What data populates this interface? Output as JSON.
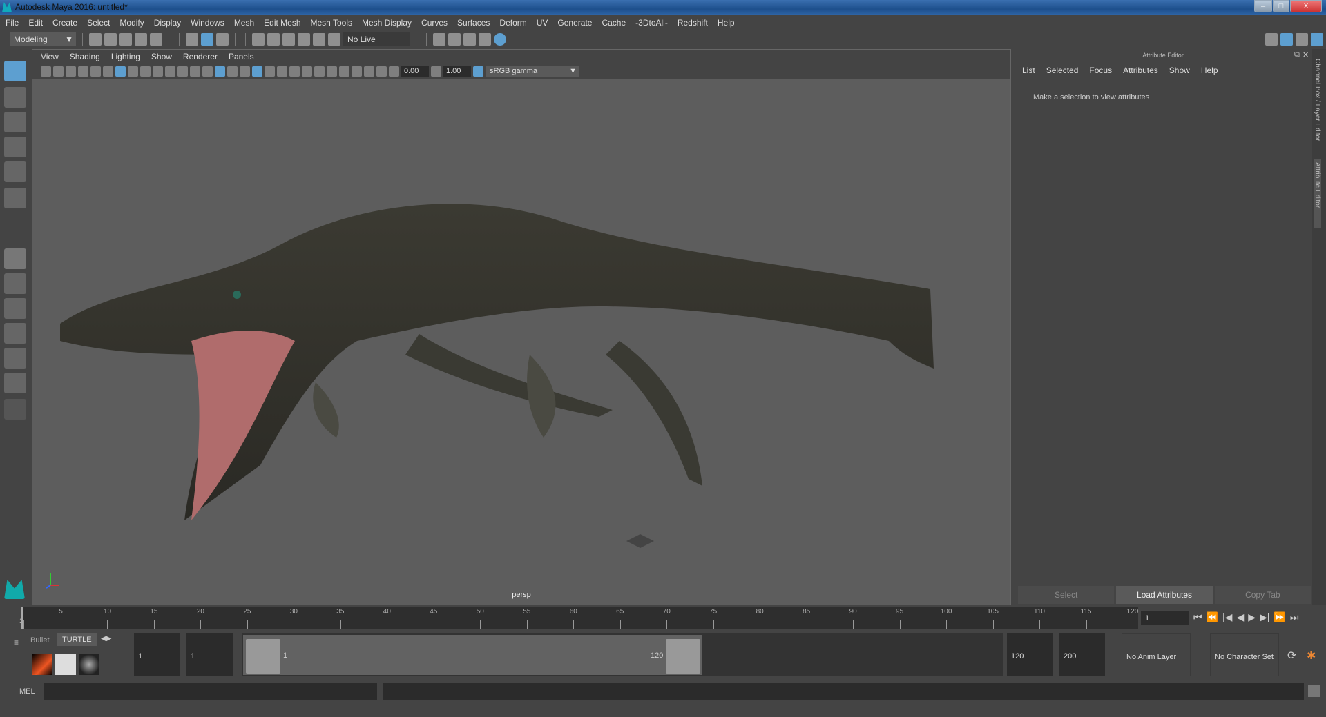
{
  "window": {
    "title": "Autodesk Maya 2016: untitled*",
    "min": "‒",
    "max": "□",
    "close": "X"
  },
  "menubar": [
    "File",
    "Edit",
    "Create",
    "Select",
    "Modify",
    "Display",
    "Windows",
    "Mesh",
    "Edit Mesh",
    "Mesh Tools",
    "Mesh Display",
    "Curves",
    "Surfaces",
    "Deform",
    "UV",
    "Generate",
    "Cache",
    "-3DtoAll-",
    "Redshift",
    "Help"
  ],
  "toolbar": {
    "mode": "Modeling",
    "live_surface": "No Live Surface"
  },
  "viewport": {
    "menu": [
      "View",
      "Shading",
      "Lighting",
      "Show",
      "Renderer",
      "Panels"
    ],
    "exposure": "0.00",
    "gamma": "1.00",
    "color_space": "sRGB gamma",
    "camera": "persp"
  },
  "attribute_editor": {
    "title": "Attribute Editor",
    "menu": [
      "List",
      "Selected",
      "Focus",
      "Attributes",
      "Show",
      "Help"
    ],
    "message": "Make a selection to view attributes",
    "buttons": [
      "Select",
      "Load Attributes",
      "Copy Tab"
    ]
  },
  "side_tabs": [
    "Channel Box / Layer Editor",
    "Attribute Editor"
  ],
  "timeline": {
    "ticks": [
      "5",
      "10",
      "15",
      "20",
      "25",
      "30",
      "35",
      "40",
      "45",
      "50",
      "55",
      "60",
      "65",
      "70",
      "75",
      "80",
      "85",
      "90",
      "95",
      "100",
      "105",
      "110",
      "115",
      "120"
    ],
    "start_label": "1",
    "current_frame": "1"
  },
  "playback": [
    "⏮",
    "⏪",
    "|◀",
    "◀",
    "▶",
    "▶|",
    "⏩",
    "⏭"
  ],
  "shelf": {
    "tabs": [
      "Bullet",
      "TURTLE"
    ]
  },
  "range": {
    "start": "1",
    "anim_start": "1",
    "range_start": "1",
    "range_end": "120",
    "end": "120",
    "anim_end": "200",
    "anim_layer": "No Anim Layer",
    "character_set": "No Character Set"
  },
  "mel": {
    "label": "MEL"
  }
}
